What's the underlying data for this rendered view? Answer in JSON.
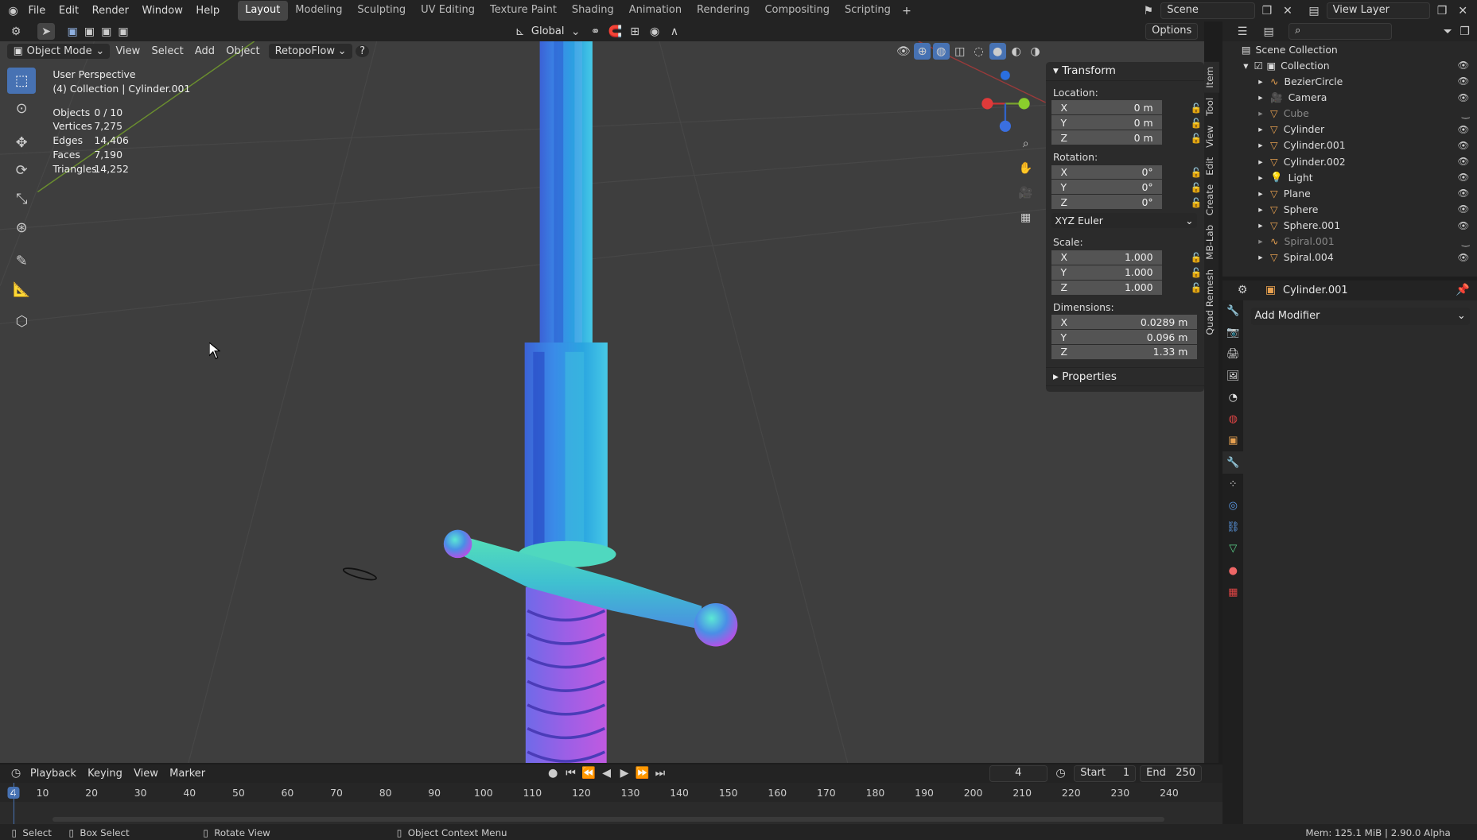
{
  "topbar": {
    "menus": [
      "File",
      "Edit",
      "Render",
      "Window",
      "Help"
    ],
    "workspaces": [
      "Layout",
      "Modeling",
      "Sculpting",
      "UV Editing",
      "Texture Paint",
      "Shading",
      "Animation",
      "Rendering",
      "Compositing",
      "Scripting"
    ],
    "active_workspace": "Layout",
    "scene": "Scene",
    "view_layer": "View Layer"
  },
  "viewport_header": {
    "orientation": "Global",
    "options": "Options",
    "mode": "Object Mode",
    "menus": [
      "View",
      "Select",
      "Add",
      "Object"
    ],
    "addon": "RetopoFlow",
    "help": "?"
  },
  "overlay": {
    "perspective": "User Perspective",
    "collection": "(4) Collection | Cylinder.001",
    "stats": [
      {
        "label": "Objects",
        "value": "0 / 10"
      },
      {
        "label": "Vertices",
        "value": "7,275"
      },
      {
        "label": "Edges",
        "value": "14,406"
      },
      {
        "label": "Faces",
        "value": "7,190"
      },
      {
        "label": "Triangles",
        "value": "14,252"
      }
    ]
  },
  "npanel": {
    "transform_title": "Transform",
    "location_label": "Location:",
    "location": [
      {
        "axis": "X",
        "value": "0 m"
      },
      {
        "axis": "Y",
        "value": "0 m"
      },
      {
        "axis": "Z",
        "value": "0 m"
      }
    ],
    "rotation_label": "Rotation:",
    "rotation": [
      {
        "axis": "X",
        "value": "0°"
      },
      {
        "axis": "Y",
        "value": "0°"
      },
      {
        "axis": "Z",
        "value": "0°"
      }
    ],
    "rotation_mode": "XYZ Euler",
    "scale_label": "Scale:",
    "scale": [
      {
        "axis": "X",
        "value": "1.000"
      },
      {
        "axis": "Y",
        "value": "1.000"
      },
      {
        "axis": "Z",
        "value": "1.000"
      }
    ],
    "dimensions_label": "Dimensions:",
    "dimensions": [
      {
        "axis": "X",
        "value": "0.0289 m"
      },
      {
        "axis": "Y",
        "value": "0.096 m"
      },
      {
        "axis": "Z",
        "value": "1.33 m"
      }
    ],
    "properties_title": "Properties"
  },
  "side_tabs": [
    "Item",
    "Tool",
    "View",
    "Edit",
    "Create",
    "MB-Lab",
    "Quad Remesh"
  ],
  "outliner": {
    "root": "Scene Collection",
    "collection": "Collection",
    "items": [
      {
        "name": "BezierCircle",
        "icon": "curve-icon",
        "dim": false
      },
      {
        "name": "Camera",
        "icon": "camera-icon",
        "dim": false
      },
      {
        "name": "Cube",
        "icon": "mesh-icon",
        "dim": true
      },
      {
        "name": "Cylinder",
        "icon": "mesh-icon",
        "dim": false
      },
      {
        "name": "Cylinder.001",
        "icon": "mesh-icon",
        "dim": false
      },
      {
        "name": "Cylinder.002",
        "icon": "mesh-icon",
        "dim": false
      },
      {
        "name": "Light",
        "icon": "light-icon",
        "dim": false
      },
      {
        "name": "Plane",
        "icon": "mesh-icon",
        "dim": false
      },
      {
        "name": "Sphere",
        "icon": "mesh-icon",
        "dim": false
      },
      {
        "name": "Sphere.001",
        "icon": "mesh-icon",
        "dim": false
      },
      {
        "name": "Spiral.001",
        "icon": "curve-icon",
        "dim": true
      },
      {
        "name": "Spiral.004",
        "icon": "mesh-icon",
        "dim": false
      }
    ]
  },
  "properties": {
    "object_name": "Cylinder.001",
    "add_modifier": "Add Modifier"
  },
  "timeline": {
    "menus": [
      "Playback",
      "Keying",
      "View",
      "Marker"
    ],
    "current_frame": "4",
    "start_label": "Start",
    "start": "1",
    "end_label": "End",
    "end": "250",
    "ticks": [
      "4",
      "10",
      "20",
      "30",
      "40",
      "50",
      "60",
      "70",
      "80",
      "90",
      "100",
      "110",
      "120",
      "130",
      "140",
      "150",
      "160",
      "170",
      "180",
      "190",
      "200",
      "210",
      "220",
      "230",
      "240"
    ]
  },
  "statusbar": {
    "select": "Select",
    "box_select": "Box Select",
    "rotate_view": "Rotate View",
    "context_menu": "Object Context Menu",
    "info": "Mem: 125.1 MiB | 2.90.0 Alpha"
  },
  "colors": {
    "accent": "#4772b3",
    "viewport_bg": "#3e3e3e"
  }
}
